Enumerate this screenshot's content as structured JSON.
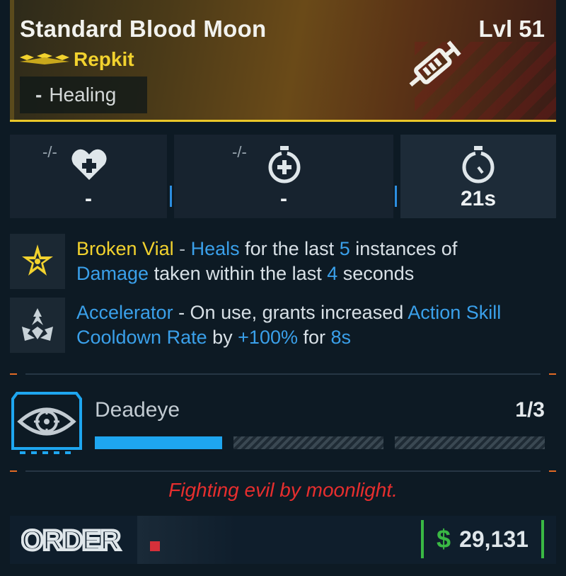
{
  "item": {
    "name": "Standard Blood Moon",
    "level": "Lvl 51",
    "type": "Repkit",
    "tag_dash": "-",
    "tag": "Healing",
    "rarity_color": "#f2d22e"
  },
  "stats": [
    {
      "badge": "-/-",
      "value": "-",
      "icon": "heart-plus-icon"
    },
    {
      "badge": "-/-",
      "value": "-",
      "icon": "stopwatch-plus-icon"
    },
    {
      "badge": "",
      "value": "21s",
      "icon": "stopwatch-icon"
    }
  ],
  "perks": [
    {
      "icon": "star-burst-icon",
      "name": "Broken Vial",
      "sep": " - ",
      "parts": [
        "Heals",
        " for the last ",
        "5",
        " instances of ",
        "Damage",
        " taken within the last ",
        "4",
        " seconds"
      ]
    },
    {
      "icon": "flame-leaf-icon",
      "name": "Accelerator",
      "sep": " - On use, grants increased ",
      "parts": [
        "Action Skill Cooldown Rate",
        " by ",
        "+100%",
        " for ",
        "8s"
      ]
    }
  ],
  "augment": {
    "name": "Deadeye",
    "count": "1/3",
    "progress": 0.333,
    "icon": "eye-target-icon"
  },
  "flavor": "Fighting evil by moonlight.",
  "footer": {
    "brand": "ORDER",
    "currency_symbol": "$",
    "price": "29,131"
  },
  "colors": {
    "accent_yellow": "#f2d22e",
    "link_blue": "#3aa0ea",
    "flavor_red": "#e62e2e",
    "money_green": "#3ab844",
    "progress_blue": "#1ea6f0"
  }
}
